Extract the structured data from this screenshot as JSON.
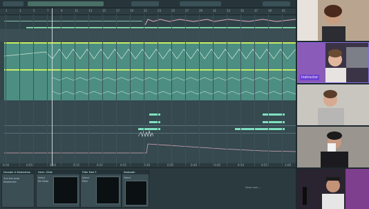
{
  "ruler_ticks": [
    "1",
    "3",
    "5",
    "7",
    "9",
    "11",
    "13",
    "15",
    "17",
    "19",
    "21",
    "23",
    "25",
    "27",
    "29",
    "31",
    "33",
    "35",
    "37",
    "39",
    "41"
  ],
  "bottom_ticks": [
    "0:00",
    "0:05",
    "0:10",
    "0:15",
    "0:20",
    "0:25",
    "0:30",
    "0:35",
    "0:40",
    "0:45",
    "0:50",
    "0:55",
    "1:00"
  ],
  "devices": [
    {
      "title": "Decoder & Modulation",
      "line1": "Turn this knob",
      "line2": "Deselected"
    },
    {
      "title": "Harm. Glide",
      "line1": "Select",
      "line2": "Rel Mode"
    },
    {
      "title": "Filter Mod 3",
      "line1": "Select",
      "line2": "Pitch"
    },
    {
      "title": "Sawtooth",
      "line1": "Select",
      "line2": "Rel"
    }
  ],
  "device_hint": "Hover over ...",
  "participants": [
    {
      "name": "",
      "bg": "#b9a58f"
    },
    {
      "name": "Instructor",
      "bg": "#6b5a7c"
    },
    {
      "name": "",
      "bg": "#c9c6c0"
    },
    {
      "name": "",
      "bg": "#9a958f"
    },
    {
      "name": "",
      "bg": "#4a3f55"
    }
  ],
  "colors": {
    "accent_clip": "#c9ee63",
    "clip_body": "#4d8e82",
    "note": "#7fe0c0",
    "instructor_tag": "#6b3fd0"
  }
}
